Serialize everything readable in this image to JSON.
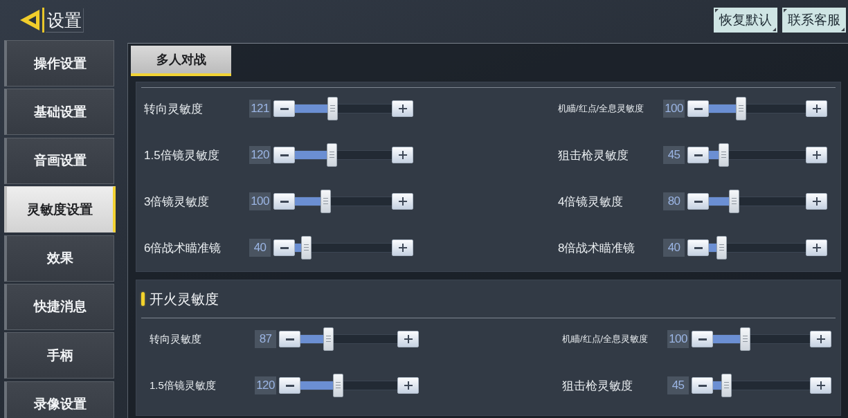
{
  "header": {
    "title": "设置",
    "actions": [
      {
        "label": "恢复默认"
      },
      {
        "label": "联系客服"
      }
    ]
  },
  "sidebar": {
    "items": [
      {
        "label": "操作设置",
        "selected": false
      },
      {
        "label": "基础设置",
        "selected": false
      },
      {
        "label": "音画设置",
        "selected": false
      },
      {
        "label": "灵敏度设置",
        "selected": true
      },
      {
        "label": "效果",
        "selected": false
      },
      {
        "label": "快捷消息",
        "selected": false
      },
      {
        "label": "手柄",
        "selected": false
      },
      {
        "label": "录像设置",
        "selected": false
      }
    ]
  },
  "tabs": [
    {
      "label": "多人对战",
      "selected": true
    }
  ],
  "sections": [
    {
      "sliders": [
        {
          "label": "转向灵敏度",
          "reading": "121",
          "level": 0.39
        },
        {
          "label": "机瞄/红点/全息灵敏度",
          "reading": "100",
          "level": 0.33
        },
        {
          "label": "1.5倍镜灵敏度",
          "reading": "120",
          "level": 0.38
        },
        {
          "label": "狙击枪灵敏度",
          "reading": "45",
          "level": 0.15
        },
        {
          "label": "3倍镜灵敏度",
          "reading": "100",
          "level": 0.32
        },
        {
          "label": "4倍镜灵敏度",
          "reading": "80",
          "level": 0.26
        },
        {
          "label": "6倍战术瞄准镜",
          "reading": "40",
          "level": 0.12
        },
        {
          "label": "8倍战术瞄准镜",
          "reading": "40",
          "level": 0.13
        }
      ]
    },
    {
      "title": "开火灵敏度",
      "sliders": [
        {
          "label": "转向灵敏度",
          "reading": "87",
          "level": 0.29
        },
        {
          "label": "机瞄/红点/全息灵敏度",
          "reading": "100",
          "level": 0.33
        },
        {
          "label": "1.5倍镜灵敏度",
          "reading": "120",
          "level": 0.39
        },
        {
          "label": "狙击枪灵敏度",
          "reading": "45",
          "level": 0.14
        }
      ]
    }
  ]
}
